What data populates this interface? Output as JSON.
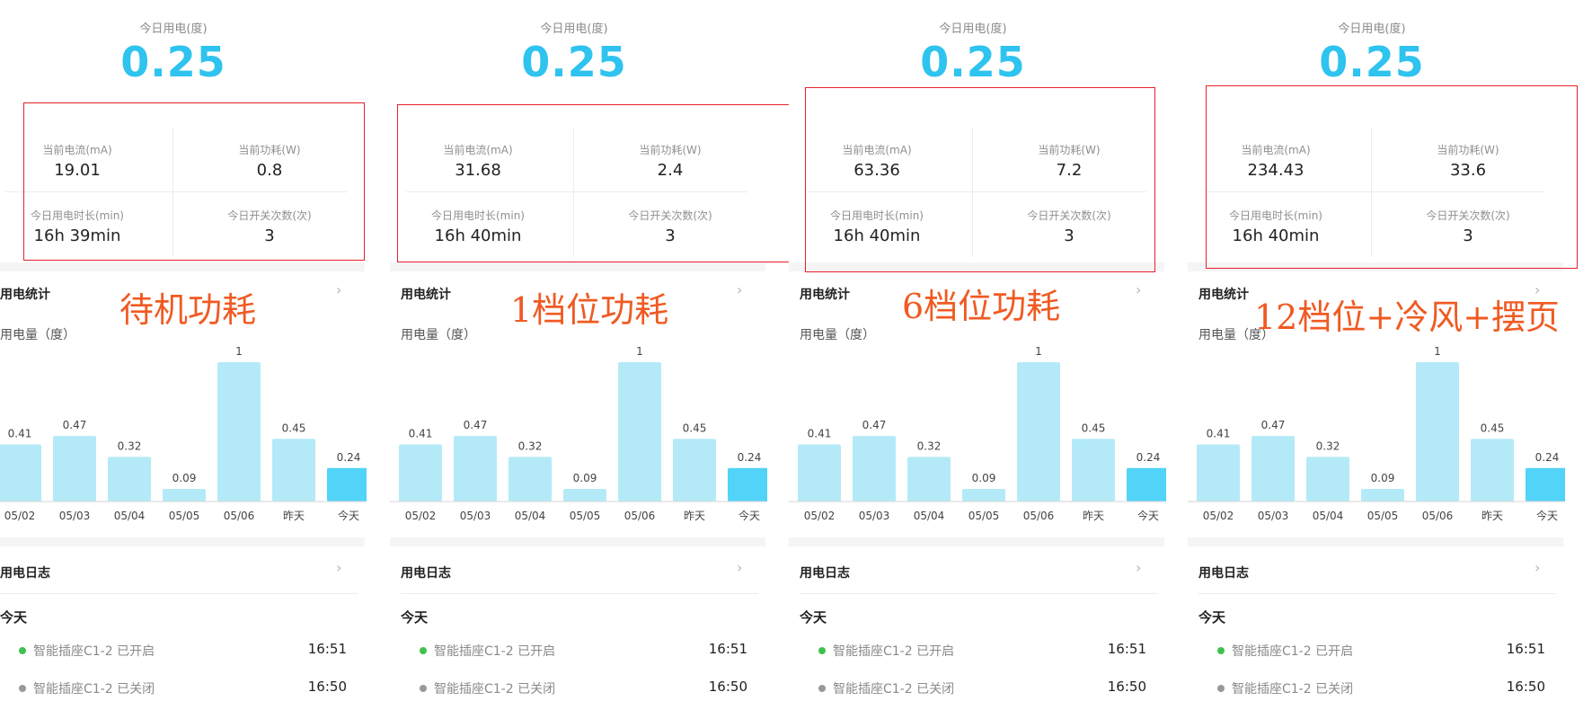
{
  "colors": {
    "accent": "#2fc3ef",
    "bar": "#b4eaf8",
    "bar_today": "#52d3f8",
    "annotation_box": "#e8202a",
    "annotation_text": "#f05a22",
    "dot_on": "#3ec24f",
    "dot_off": "#999999"
  },
  "panels": [
    {
      "today_label": "今日用电(度)",
      "today_value": "0.25",
      "stats": {
        "current_label": "当前电流(mA)",
        "current_value": "19.01",
        "power_label": "当前功耗(W)",
        "power_value": "0.8",
        "duration_label": "今日用电时长(min)",
        "duration_value": "16h 39min",
        "switch_label": "今日开关次数(次)",
        "switch_value": "3"
      },
      "stats_title": "用电统计",
      "chart_unit": "用电量（度）",
      "log_title": "用电日志",
      "log_day": "今天",
      "log": [
        {
          "text": "智能插座C1-2 已开启",
          "time": "16:51",
          "state": "on"
        },
        {
          "text": "智能插座C1-2 已关闭",
          "time": "16:50",
          "state": "off"
        }
      ],
      "annotation": "待机功耗"
    },
    {
      "today_label": "今日用电(度)",
      "today_value": "0.25",
      "stats": {
        "current_label": "当前电流(mA)",
        "current_value": "31.68",
        "power_label": "当前功耗(W)",
        "power_value": "2.4",
        "duration_label": "今日用电时长(min)",
        "duration_value": "16h 40min",
        "switch_label": "今日开关次数(次)",
        "switch_value": "3"
      },
      "stats_title": "用电统计",
      "chart_unit": "用电量（度）",
      "log_title": "用电日志",
      "log_day": "今天",
      "log": [
        {
          "text": "智能插座C1-2 已开启",
          "time": "16:51",
          "state": "on"
        },
        {
          "text": "智能插座C1-2 已关闭",
          "time": "16:50",
          "state": "off"
        }
      ],
      "annotation": "1档位功耗"
    },
    {
      "today_label": "今日用电(度)",
      "today_value": "0.25",
      "stats": {
        "current_label": "当前电流(mA)",
        "current_value": "63.36",
        "power_label": "当前功耗(W)",
        "power_value": "7.2",
        "duration_label": "今日用电时长(min)",
        "duration_value": "16h 40min",
        "switch_label": "今日开关次数(次)",
        "switch_value": "3"
      },
      "stats_title": "用电统计",
      "chart_unit": "用电量（度）",
      "log_title": "用电日志",
      "log_day": "今天",
      "log": [
        {
          "text": "智能插座C1-2 已开启",
          "time": "16:51",
          "state": "on"
        },
        {
          "text": "智能插座C1-2 已关闭",
          "time": "16:50",
          "state": "off"
        }
      ],
      "annotation": "6档位功耗"
    },
    {
      "today_label": "今日用电(度)",
      "today_value": "0.25",
      "stats": {
        "current_label": "当前电流(mA)",
        "current_value": "234.43",
        "power_label": "当前功耗(W)",
        "power_value": "33.6",
        "duration_label": "今日用电时长(min)",
        "duration_value": "16h 40min",
        "switch_label": "今日开关次数(次)",
        "switch_value": "3"
      },
      "stats_title": "用电统计",
      "chart_unit": "用电量（度）",
      "log_title": "用电日志",
      "log_day": "今天",
      "log": [
        {
          "text": "智能插座C1-2 已开启",
          "time": "16:51",
          "state": "on"
        },
        {
          "text": "智能插座C1-2 已关闭",
          "time": "16:50",
          "state": "off"
        }
      ],
      "annotation": "12档位+冷风+摆页"
    }
  ],
  "chart_data": {
    "type": "bar",
    "categories": [
      "05/02",
      "05/03",
      "05/04",
      "05/05",
      "05/06",
      "昨天",
      "今天"
    ],
    "values": [
      0.41,
      0.47,
      0.32,
      0.09,
      1,
      0.45,
      0.24
    ],
    "value_labels": [
      "0.41",
      "0.47",
      "0.32",
      "0.09",
      "1",
      "0.45",
      "0.24"
    ],
    "ylim": [
      0,
      1
    ],
    "highlight_category": "今天"
  }
}
